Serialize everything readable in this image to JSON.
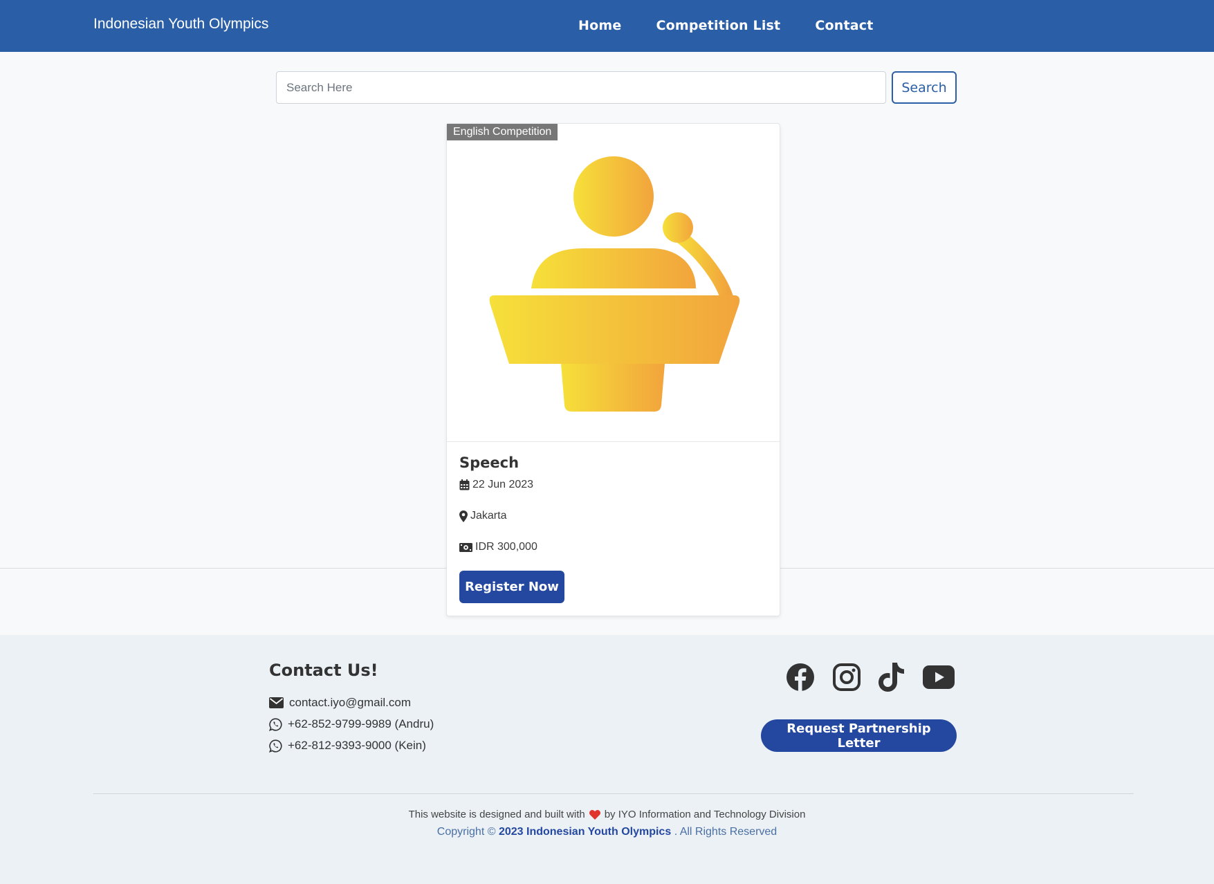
{
  "navbar": {
    "brand": "Indonesian Youth Olympics",
    "links": [
      "Home",
      "Competition List",
      "Contact"
    ]
  },
  "search": {
    "placeholder": "Search Here",
    "button_label": "Search"
  },
  "card": {
    "badge": "English Competition",
    "image_icon": "speech-podium-icon",
    "title": "Speech",
    "date": "22 Jun 2023",
    "location": "Jakarta",
    "fee": "IDR 300,000",
    "register_label": "Register Now"
  },
  "footer": {
    "contact_title": "Contact Us!",
    "email": "contact.iyo@gmail.com",
    "phones": [
      "+62-852-9799-9989 (Andru)",
      "+62-812-9393-9000 (Kein)"
    ],
    "socials": [
      "facebook-icon",
      "instagram-icon",
      "tiktok-icon",
      "youtube-icon"
    ],
    "partnership_label": "Request Partnership Letter",
    "credit_prefix": "This website is designed and built with",
    "credit_suffix": "by IYO Information and Technology Division",
    "copyright_prefix": "Copyright ©",
    "copyright_bold": "2023 Indonesian Youth Olympics",
    "copyright_suffix": ". All Rights Reserved"
  },
  "colors": {
    "navbar": "#2a5ea6",
    "primary_button": "#2448a0",
    "footer_bg": "#ebf1f5",
    "icon_gradient_start": "#f6e03a",
    "icon_gradient_end": "#f2a43c"
  }
}
